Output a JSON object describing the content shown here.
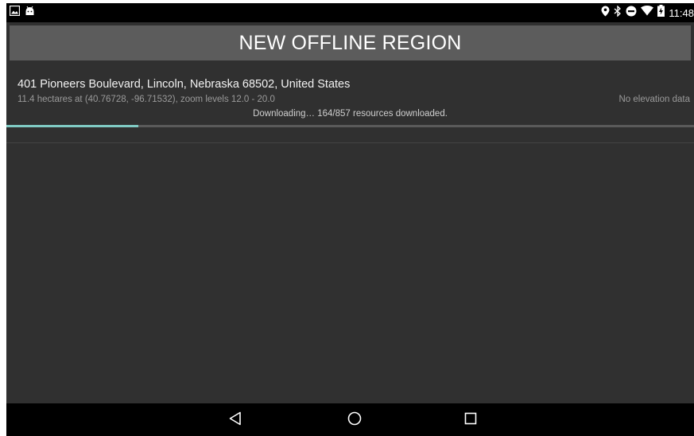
{
  "status_bar": {
    "time": "11:48",
    "left_icons": [
      "image-notification-icon",
      "android-notification-icon"
    ],
    "right_icons": [
      "location-icon",
      "bluetooth-icon",
      "do-not-disturb-icon",
      "wifi-icon",
      "battery-charging-icon"
    ]
  },
  "header": {
    "title": "NEW OFFLINE REGION"
  },
  "region": {
    "name": "401 Pioneers Boulevard, Lincoln, Nebraska 68502, United States",
    "details": "11.4 hectares at (40.76728, -96.71532), zoom levels 12.0 - 20.0",
    "elevation": "No elevation data",
    "status": "Downloading… 164/857 resources downloaded.",
    "progress_downloaded": 164,
    "progress_total": 857
  },
  "nav_bar": {
    "buttons": [
      "back-icon",
      "home-icon",
      "recents-icon"
    ]
  },
  "colors": {
    "background": "#303030",
    "title_bar": "#5c5c5c",
    "progress": "#80cbc4",
    "progress_track": "#5a5a5a"
  }
}
